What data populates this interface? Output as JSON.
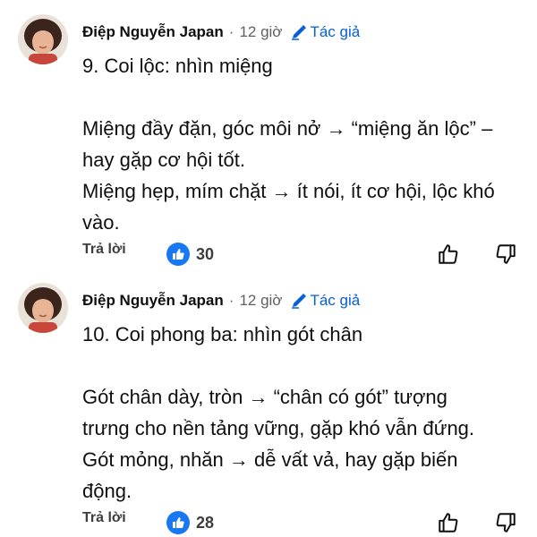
{
  "comments": [
    {
      "author": "Điệp Nguyễn Japan",
      "separator": "·",
      "time": "12 giờ",
      "author_badge": "Tác giả",
      "lines": [
        "9. Coi lộc: nhìn miệng",
        "",
        "Miệng đầy đặn, góc môi nở → “miệng ăn lộc” –",
        "hay gặp cơ hội tốt.",
        "Miệng hẹp, mím chặt → ít nói, ít cơ hội, lộc khó",
        "vào."
      ],
      "reply_label": "Trả lời",
      "like_count": "30"
    },
    {
      "author": "Điệp Nguyễn Japan",
      "separator": "·",
      "time": "12 giờ",
      "author_badge": "Tác giả",
      "lines": [
        "10. Coi phong ba: nhìn gót chân",
        "",
        "Gót chân dày, tròn → “chân có gót” tượng",
        "trưng cho nền tảng vững, gặp khó vẫn đứng.",
        "Gót mỏng, nhăn → dễ vất vả, hay gặp biến",
        "động."
      ],
      "reply_label": "Trả lời",
      "like_count": "28"
    }
  ],
  "icons": {
    "pencil": "pencil-icon",
    "like": "like-icon",
    "thumb_up": "thumb-up-icon",
    "thumb_down": "thumb-down-icon"
  },
  "colors": {
    "author_badge": "#065fd4",
    "like_bubble": "#1877f2",
    "meta_text": "#606060"
  }
}
